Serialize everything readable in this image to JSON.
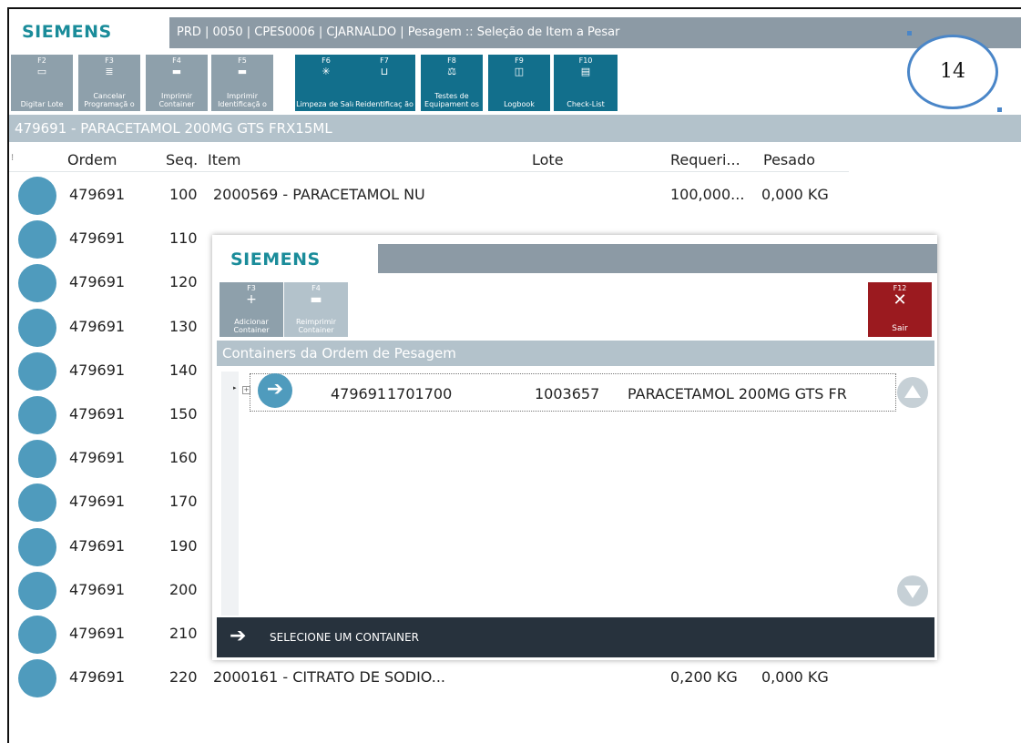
{
  "app": {
    "brand": "SIEMENS",
    "title": "PRD | 0050 | CPES0006 | CJARNALDO | Pesagem :: Seleção de Item a Pesar"
  },
  "toolbar": [
    {
      "key": "F2",
      "icon": "keyboard-icon",
      "label": "Digitar Lote",
      "style": "grey"
    },
    {
      "key": "F3",
      "icon": "cancel-schedule-icon",
      "label": "Cancelar Programaçã o",
      "style": "grey"
    },
    {
      "key": "F4",
      "icon": "printer-icon",
      "label": "Imprimir Container",
      "style": "grey"
    },
    {
      "key": "F5",
      "icon": "printer-icon",
      "label": "Imprimir Identificaçã o",
      "style": "grey"
    },
    {
      "key": "F6",
      "icon": "cleaning-icon",
      "label": "Limpeza de Sala",
      "style": "teal"
    },
    {
      "key": "F7",
      "icon": "reidentify-icon",
      "label": "Reidentificaç ão",
      "style": "teal"
    },
    {
      "key": "F8",
      "icon": "scale-icon",
      "label": "Testes de Equipament os",
      "style": "teal"
    },
    {
      "key": "F9",
      "icon": "book-icon",
      "label": "Logbook",
      "style": "teal"
    },
    {
      "key": "F10",
      "icon": "clipboard-icon",
      "label": "Check-List",
      "style": "teal"
    }
  ],
  "badge": "14",
  "order_header": "479691 - PARACETAMOL 200MG GTS FRX15ML",
  "grid": {
    "columns": [
      "Ordem",
      "Seq.",
      "Item",
      "Lote",
      "Requeri...",
      "Pesado"
    ],
    "rows": [
      {
        "ordem": "479691",
        "seq": "100",
        "item": "2000569 - PARACETAMOL NU",
        "lote": "",
        "req": "100,000...",
        "pesado": "0,000 KG"
      },
      {
        "ordem": "479691",
        "seq": "110",
        "item": "",
        "lote": "",
        "req": "",
        "pesado": ""
      },
      {
        "ordem": "479691",
        "seq": "120",
        "item": "",
        "lote": "",
        "req": "",
        "pesado": ""
      },
      {
        "ordem": "479691",
        "seq": "130",
        "item": "",
        "lote": "",
        "req": "",
        "pesado": ""
      },
      {
        "ordem": "479691",
        "seq": "140",
        "item": "",
        "lote": "",
        "req": "",
        "pesado": ""
      },
      {
        "ordem": "479691",
        "seq": "150",
        "item": "",
        "lote": "",
        "req": "",
        "pesado": ""
      },
      {
        "ordem": "479691",
        "seq": "160",
        "item": "",
        "lote": "",
        "req": "",
        "pesado": ""
      },
      {
        "ordem": "479691",
        "seq": "170",
        "item": "",
        "lote": "",
        "req": "",
        "pesado": ""
      },
      {
        "ordem": "479691",
        "seq": "190",
        "item": "",
        "lote": "",
        "req": "",
        "pesado": ""
      },
      {
        "ordem": "479691",
        "seq": "200",
        "item": "",
        "lote": "",
        "req": "",
        "pesado": ""
      },
      {
        "ordem": "479691",
        "seq": "210",
        "item": "",
        "lote": "",
        "req": "",
        "pesado": ""
      },
      {
        "ordem": "479691",
        "seq": "220",
        "item": "2000161 - CITRATO DE SODIO...",
        "lote": "",
        "req": "0,200 KG",
        "pesado": "0,000 KG"
      }
    ]
  },
  "dialog": {
    "brand": "SIEMENS",
    "toolbar": [
      {
        "key": "F3",
        "icon": "plus-icon",
        "label": "Adicionar Container"
      },
      {
        "key": "F4",
        "icon": "printer-icon",
        "label": "Reimprimir Container"
      }
    ],
    "close": {
      "key": "F12",
      "label": "Sair"
    },
    "section_title": "Containers da Ordem de Pesagem",
    "container": {
      "order": "479691",
      "container": "1701700",
      "item_code": "1003657",
      "description": "PARACETAMOL 200MG GTS FR"
    },
    "footer": "SELECIONE UM CONTAINER"
  },
  "colors": {
    "teal": "#126f8c",
    "grey": "#8ea0ab",
    "accent": "#4f9bbd",
    "close": "#9b1a1f",
    "footer": "#27323d"
  }
}
